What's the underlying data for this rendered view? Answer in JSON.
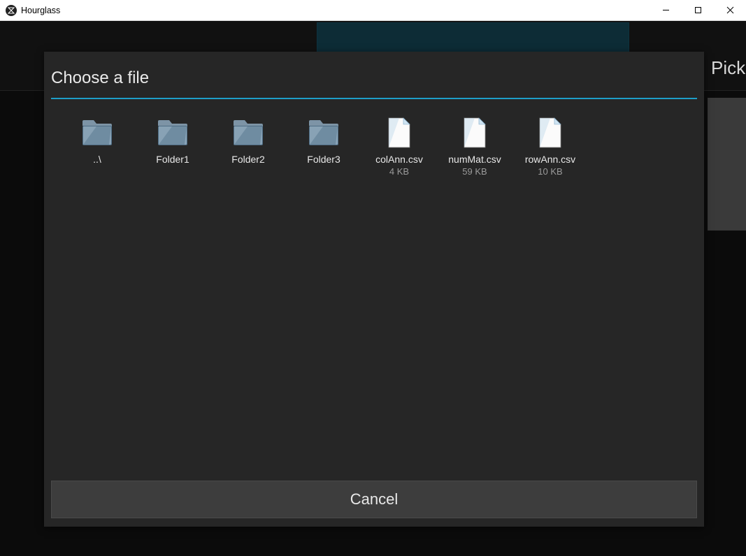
{
  "window": {
    "title": "Hourglass"
  },
  "background": {
    "right_label": "Pick"
  },
  "dialog": {
    "title": "Choose a file",
    "cancel_label": "Cancel",
    "items": [
      {
        "kind": "folder",
        "label": "..\\",
        "size": ""
      },
      {
        "kind": "folder",
        "label": "Folder1",
        "size": ""
      },
      {
        "kind": "folder",
        "label": "Folder2",
        "size": ""
      },
      {
        "kind": "folder",
        "label": "Folder3",
        "size": ""
      },
      {
        "kind": "file",
        "label": "colAnn.csv",
        "size": "4 KB"
      },
      {
        "kind": "file",
        "label": "numMat.csv",
        "size": "59 KB"
      },
      {
        "kind": "file",
        "label": "rowAnn.csv",
        "size": "10 KB"
      }
    ]
  }
}
